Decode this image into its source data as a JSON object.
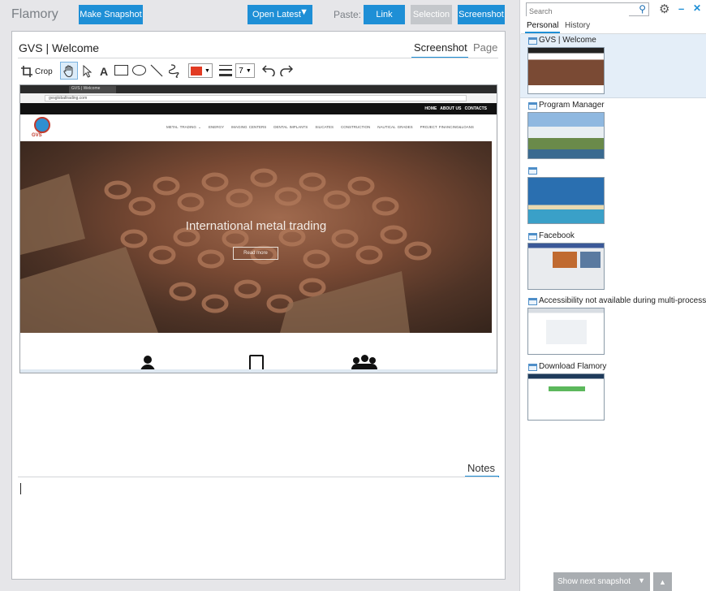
{
  "app": {
    "title": "Flamory"
  },
  "toolbar": {
    "make_snapshot": "Make Snapshot",
    "open_latest": "Open Latest",
    "paste_label": "Paste:",
    "paste_link": "Link",
    "paste_selection": "Selection",
    "paste_screenshot": "Screenshot"
  },
  "document": {
    "title": "GVS | Welcome",
    "tabs": [
      {
        "label": "Screenshot",
        "active": true
      },
      {
        "label": "Page",
        "active": false
      }
    ],
    "notes_label": "Notes"
  },
  "editor": {
    "crop_label": "Crop",
    "text_tool": "A",
    "color": "#e23a22",
    "line_width": "7"
  },
  "shot": {
    "tab_title": "GVS | Welcome",
    "url": "gvsglobaltrading.com",
    "topnav": [
      "HOME",
      "ABOUT US",
      "CONTACTS"
    ],
    "mainnav": [
      "METAL TRADING ⌄",
      "ENERGY",
      "IMAGING CENTERS",
      "DENTAL IMPLANTS",
      "SILICATES",
      "CONSTRUCTION",
      "NAUTICAL GRADES",
      "PROJECT FINANCING&LOANS"
    ],
    "logo": "GVS",
    "hero_text": "International metal trading",
    "hero_button": "Read more"
  },
  "sidebar": {
    "search_placeholder": "Search",
    "tabs": [
      {
        "label": "Personal",
        "active": true
      },
      {
        "label": "History",
        "active": false
      }
    ],
    "items": [
      {
        "title": "GVS | Welcome"
      },
      {
        "title": "Program Manager"
      },
      {
        "title": ""
      },
      {
        "title": "Facebook"
      },
      {
        "title": "Accessibility not available during multi-process s"
      },
      {
        "title": "Download Flamory"
      }
    ],
    "show_next": "Show next snapshot"
  }
}
